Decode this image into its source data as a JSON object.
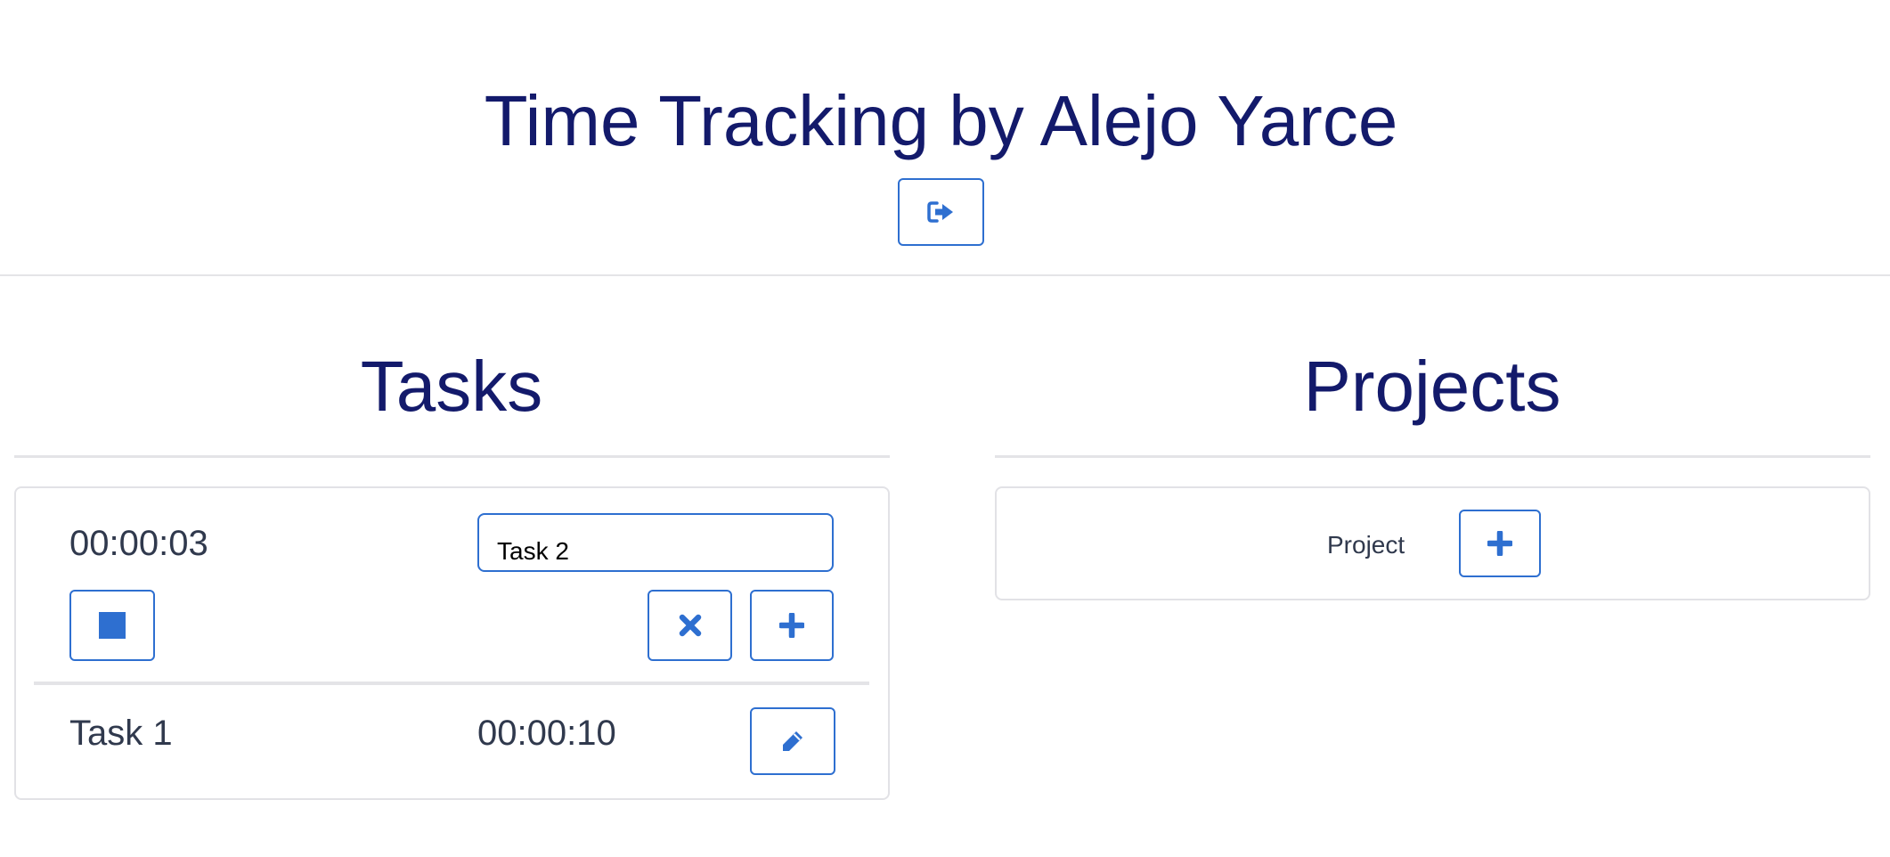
{
  "header": {
    "title": "Time Tracking by Alejo Yarce",
    "logout_icon": "sign-out-icon"
  },
  "tasks": {
    "title": "Tasks",
    "current": {
      "timer": "00:00:03",
      "input_value": "Task 2",
      "stop_icon": "stop-icon",
      "cancel_icon": "close-icon",
      "add_icon": "plus-icon"
    },
    "list": [
      {
        "name": "Task 1",
        "time": "00:00:10",
        "edit_icon": "pencil-icon"
      }
    ]
  },
  "projects": {
    "title": "Projects",
    "label": "Project",
    "add_icon": "plus-icon"
  },
  "colors": {
    "heading": "#131a6b",
    "accent": "#2e6fd0",
    "text": "#30394d",
    "divider": "#e4e4e7"
  }
}
